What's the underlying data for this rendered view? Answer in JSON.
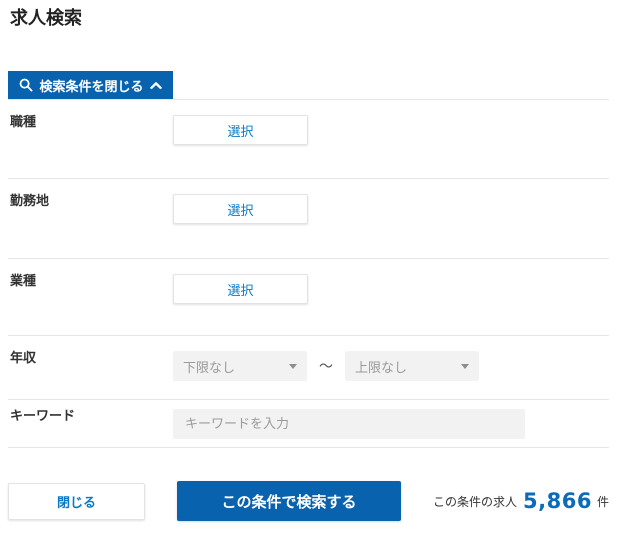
{
  "page": {
    "title": "求人検索"
  },
  "search_panel": {
    "toggle": {
      "label": "検索条件を閉じる",
      "icons": [
        "search-icon",
        "chevron-up-icon"
      ]
    },
    "rows": [
      {
        "label": "職種",
        "type": "select-button",
        "button_label": "選択"
      },
      {
        "label": "勤務地",
        "type": "select-button",
        "button_label": "選択"
      },
      {
        "label": "業種",
        "type": "select-button",
        "button_label": "選択"
      },
      {
        "label": "年収",
        "type": "range-select",
        "min_value": "下限なし",
        "separator": "～",
        "max_value": "上限なし"
      },
      {
        "label": "キーワード",
        "type": "text-input",
        "value": "",
        "placeholder": "キーワードを入力"
      }
    ],
    "footer": {
      "close_label": "閉じる",
      "search_label": "この条件で検索する",
      "count_prefix": "この条件の求人",
      "count_value": "5,866",
      "count_suffix": "件"
    }
  },
  "colors": {
    "primary_blue": "#0962ae",
    "link_blue": "#0a7ac4",
    "count_blue": "#0a6cb8",
    "divider": "#e6e6e6",
    "field_gray": "#f2f2f2"
  }
}
